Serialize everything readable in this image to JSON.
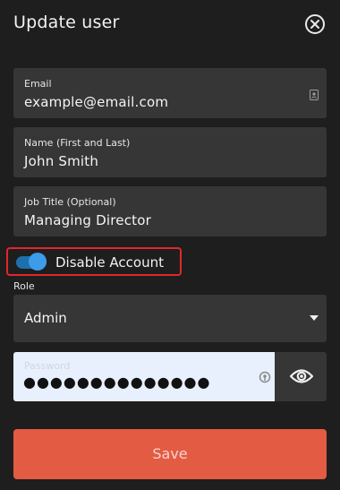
{
  "dialog": {
    "title": "Update user",
    "close_icon": "close-circle-icon"
  },
  "form": {
    "email": {
      "label": "Email",
      "value": "example@email.com",
      "icon": "contact-card-icon"
    },
    "name": {
      "label": "Name (First and Last)",
      "value": "John Smith"
    },
    "job_title": {
      "label": "Job Title (Optional)",
      "value": "Managing Director"
    },
    "disable_account": {
      "label": "Disable Account",
      "checked": true,
      "highlight_color": "#e3262b",
      "toggle_color": "#3d9bea"
    },
    "role": {
      "label": "Role",
      "selected": "Admin"
    },
    "password": {
      "placeholder": "Password",
      "masked_value": "●●●●●●●●●●●●●●",
      "icon": "key-icon",
      "toggle_icon": "eye-icon"
    },
    "save_label": "Save"
  },
  "colors": {
    "background": "#1e1e1e",
    "field": "#363636",
    "password_bg": "#e8f0fe",
    "save_button": "#e35b43"
  }
}
